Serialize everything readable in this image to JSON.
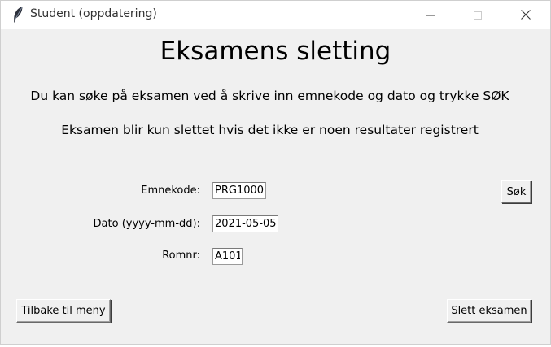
{
  "window": {
    "title": "Student (oppdatering)",
    "icon": "feather-icon",
    "controls": [
      "minimize-icon",
      "maximize-icon",
      "close-icon"
    ]
  },
  "heading": "Eksamens sletting",
  "info": {
    "line1": "Du kan søke på eksamen ved å skrive inn emnekode og dato og trykke SØK",
    "line2": "Eksamen blir kun slettet hvis det ikke er noen resultater registrert"
  },
  "form": {
    "emnekode": {
      "label": "Emnekode:",
      "value": "PRG1000"
    },
    "dato": {
      "label": "Dato (yyyy-mm-dd):",
      "value": "2021-05-05"
    },
    "romnr": {
      "label": "Romnr:",
      "value": "A101"
    }
  },
  "buttons": {
    "search": "Søk",
    "back": "Tilbake til meny",
    "delete": "Slett eksamen"
  }
}
